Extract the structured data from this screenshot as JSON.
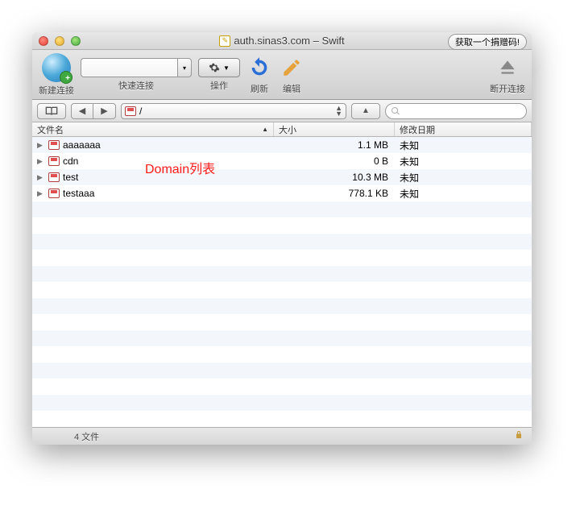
{
  "titlebar": {
    "title": "auth.sinas3.com – Swift",
    "donation_button": "获取一个捐赠码!"
  },
  "toolbar": {
    "new_connection": "新建连接",
    "quick_connect": "快速连接",
    "action": "操作",
    "refresh": "刷新",
    "edit": "编辑",
    "disconnect": "断开连接"
  },
  "navbar": {
    "path": "/",
    "search_placeholder": ""
  },
  "columns": {
    "name": "文件名",
    "size": "大小",
    "date": "修改日期"
  },
  "rows": [
    {
      "name": "aaaaaaa",
      "size": "1.1 MB",
      "date": "未知"
    },
    {
      "name": "cdn",
      "size": "0 B",
      "date": "未知"
    },
    {
      "name": "test",
      "size": "10.3 MB",
      "date": "未知"
    },
    {
      "name": "testaaa",
      "size": "778.1 KB",
      "date": "未知"
    }
  ],
  "annotation": "Domain列表",
  "statusbar": {
    "count": "4 文件"
  }
}
